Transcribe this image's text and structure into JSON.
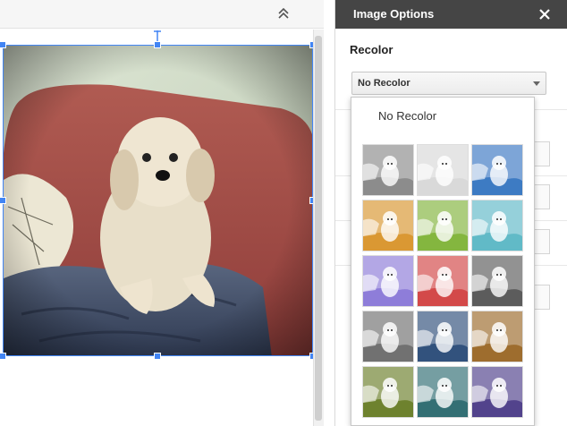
{
  "panel": {
    "title": "Image Options",
    "close_icon": "close-icon",
    "section": "Recolor",
    "dropdown_value": "No Recolor"
  },
  "menu": {
    "no_recolor_label": "No Recolor",
    "swatches": [
      {
        "name": "grayscale-light",
        "tint": "#8a8a8a"
      },
      {
        "name": "grayscale-faded",
        "tint": "#d8d8d8"
      },
      {
        "name": "light-blue",
        "tint": "#3a78c2"
      },
      {
        "name": "orange",
        "tint": "#d9962f"
      },
      {
        "name": "green",
        "tint": "#82b43c"
      },
      {
        "name": "teal",
        "tint": "#5eb8c6"
      },
      {
        "name": "purple",
        "tint": "#8c7ad8"
      },
      {
        "name": "red",
        "tint": "#d24646"
      },
      {
        "name": "grayscale-dark",
        "tint": "#5a5a5a"
      },
      {
        "name": "gray",
        "tint": "#6f6f6f"
      },
      {
        "name": "dark-blue",
        "tint": "#2e4f7a"
      },
      {
        "name": "brown",
        "tint": "#9c6a2a"
      },
      {
        "name": "olive-green",
        "tint": "#6b7f2a"
      },
      {
        "name": "dark-teal",
        "tint": "#2f6d72"
      },
      {
        "name": "dark-purple",
        "tint": "#4f3f8a"
      }
    ]
  },
  "colors": {
    "accent": "#4285f4",
    "panel_header": "#454545"
  }
}
